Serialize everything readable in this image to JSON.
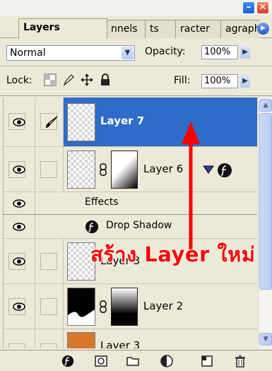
{
  "window": {
    "minimize_glyph": "–",
    "close_glyph": "✕"
  },
  "tabs": [
    {
      "label": "Layers",
      "active": true
    },
    {
      "label": "nnels",
      "active": false
    },
    {
      "label": "ts",
      "active": false
    },
    {
      "label": "racter",
      "active": false
    },
    {
      "label": "agraph",
      "active": false
    }
  ],
  "options": {
    "blend_mode": "Normal",
    "opacity_label": "Opacity:",
    "opacity_value": "100%",
    "lock_label": "Lock:",
    "fill_label": "Fill:",
    "fill_value": "100%"
  },
  "layers": [
    {
      "name": "Layer 7",
      "selected": true
    },
    {
      "name": "Layer 6",
      "selected": false
    },
    {
      "name": "Effects",
      "selected": false
    },
    {
      "name": "Drop Shadow",
      "selected": false
    },
    {
      "name": "Layer 3",
      "selected": false
    },
    {
      "name": "Layer 2",
      "selected": false
    },
    {
      "name": "Layer 3",
      "selected": false
    }
  ],
  "annotation": {
    "text": "สร้าง Layer ใหม่",
    "color": "#ff0000"
  },
  "colors": {
    "selection": "#2d6cc8",
    "panel": "#ece9d8"
  },
  "icons": [
    "eye-icon",
    "brush-icon",
    "chain-link-icon",
    "fx-icon",
    "layer-style-icon",
    "mask-icon",
    "folder-icon",
    "adjustment-icon",
    "new-layer-icon",
    "trash-icon"
  ]
}
